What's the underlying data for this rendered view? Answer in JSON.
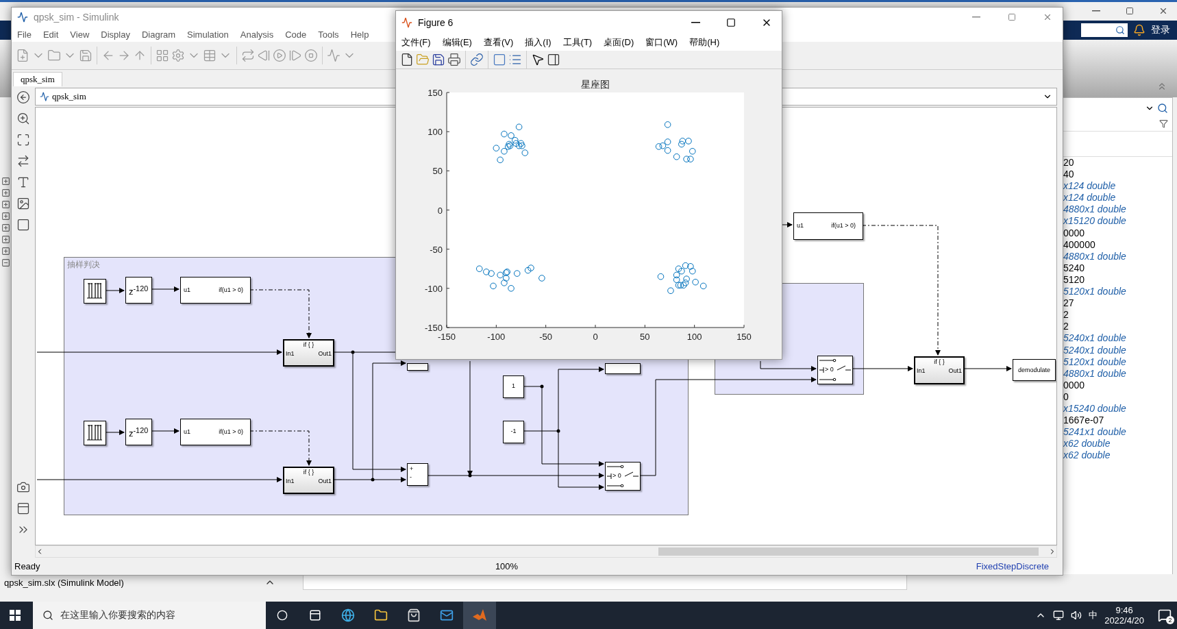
{
  "matlab_desktop": {
    "sign_in": "登录",
    "workspace_values": [
      {
        "value": "20",
        "kind": "scalar"
      },
      {
        "value": "40",
        "kind": "scalar"
      },
      {
        "value": "x124 double",
        "kind": "array"
      },
      {
        "value": "x124 double",
        "kind": "array"
      },
      {
        "value": "4880x1 double",
        "kind": "array"
      },
      {
        "value": "x15120 double",
        "kind": "array"
      },
      {
        "value": "0000",
        "kind": "scalar"
      },
      {
        "value": "400000",
        "kind": "scalar"
      },
      {
        "value": "4880x1 double",
        "kind": "array"
      },
      {
        "value": "5240",
        "kind": "scalar"
      },
      {
        "value": "5120",
        "kind": "scalar"
      },
      {
        "value": "5120x1 double",
        "kind": "array"
      },
      {
        "value": "27",
        "kind": "scalar"
      },
      {
        "value": "2",
        "kind": "scalar"
      },
      {
        "value": "2",
        "kind": "scalar"
      },
      {
        "value": "5240x1 double",
        "kind": "array"
      },
      {
        "value": "5240x1 double",
        "kind": "array"
      },
      {
        "value": "5120x1 double",
        "kind": "array"
      },
      {
        "value": "4880x1 double",
        "kind": "array"
      },
      {
        "value": "0000",
        "kind": "scalar"
      },
      {
        "value": "0",
        "kind": "scalar"
      },
      {
        "value": "x15240 double",
        "kind": "array"
      },
      {
        "value": "1667e-07",
        "kind": "scalar"
      },
      {
        "value": "5241x1 double",
        "kind": "array"
      },
      {
        "value": "x62 double",
        "kind": "array"
      },
      {
        "value": "x62 double",
        "kind": "array"
      }
    ],
    "file_bar": {
      "label": "qpsk_sim.slx  (Simulink Model)"
    }
  },
  "simulink": {
    "title": "qpsk_sim - Simulink",
    "menu": [
      "File",
      "Edit",
      "View",
      "Display",
      "Diagram",
      "Simulation",
      "Analysis",
      "Code",
      "Tools",
      "Help"
    ],
    "tabs": [
      {
        "label": "qpsk_sim",
        "selected": true
      }
    ],
    "breadcrumb": "qpsk_sim",
    "diagram": {
      "area_label": "抽样判决",
      "blocks": [
        {
          "kind": "repeating"
        },
        {
          "kind": "delay",
          "text": "z$^{-120}$"
        },
        {
          "kind": "compare",
          "input": "u1",
          "condition": "if(u1 > 0)"
        },
        {
          "kind": "action",
          "title": "if { }",
          "input": "In1",
          "output": "Out1"
        },
        {
          "kind": "repeating"
        },
        {
          "kind": "delay",
          "text": "z$^{-120}$"
        },
        {
          "kind": "compare",
          "input": "u1",
          "condition": "if(u1 > 0)"
        },
        {
          "kind": "action",
          "title": "if { }",
          "input": "In1",
          "output": "Out1"
        },
        {
          "kind": "sum"
        },
        {
          "kind": "sum",
          "signs": [
            "+",
            "-"
          ]
        },
        {
          "kind": "constant",
          "text": "1"
        },
        {
          "kind": "constant",
          "text": "-1"
        },
        {
          "kind": "switch"
        },
        {
          "kind": "switch",
          "text": "> 0"
        },
        {
          "kind": "compare",
          "input": "u1",
          "condition": "if(u1 > 0)"
        },
        {
          "kind": "switch",
          "text": "> 0"
        },
        {
          "kind": "action",
          "title": "if { }",
          "input": "In1",
          "output": "Out1"
        },
        {
          "kind": "sink",
          "text": "demodulate"
        }
      ]
    },
    "status": {
      "state": "Ready",
      "zoom": "100%",
      "solver": "FixedStepDiscrete"
    }
  },
  "figure": {
    "title": "Figure 6",
    "menu": [
      "文件(F)",
      "编辑(E)",
      "查看(V)",
      "插入(I)",
      "工具(T)",
      "桌面(D)",
      "窗口(W)",
      "帮助(H)"
    ],
    "chart_data": {
      "type": "scatter",
      "title": "星座图",
      "xlim": [
        -150,
        150
      ],
      "ylim": [
        -150,
        150
      ],
      "xticks": [
        -150,
        -100,
        -50,
        0,
        50,
        100,
        150
      ],
      "yticks": [
        -150,
        -100,
        -50,
        0,
        50,
        100,
        150
      ],
      "series": [
        {
          "color": "#0072bd",
          "x": [
            -77,
            -92,
            -85,
            -81,
            -87,
            -80,
            -75,
            -77,
            -74,
            -86,
            -88,
            -100,
            -92,
            -71,
            -96,
            73,
            73,
            64,
            68,
            73,
            87,
            88,
            94,
            98,
            82,
            92,
            96,
            -117,
            -110,
            -105,
            -96,
            -90,
            -89,
            -90,
            -92,
            -103,
            -85,
            -79,
            -68,
            -65,
            -54,
            66,
            84,
            87,
            91,
            96,
            98,
            82,
            82,
            92,
            101,
            109,
            76,
            84,
            86,
            89,
            91
          ],
          "values": [
            106,
            97,
            95,
            89,
            84,
            85,
            85,
            82,
            82,
            82,
            81,
            79,
            75,
            73,
            64,
            109,
            87,
            81,
            82,
            76,
            84,
            88,
            88,
            75,
            68,
            65,
            65,
            -75,
            -79,
            -81,
            -83,
            -80,
            -79,
            -87,
            -93,
            -97,
            -100,
            -81,
            -77,
            -74,
            -87,
            -85,
            -75,
            -78,
            -71,
            -72,
            -78,
            -83,
            -89,
            -88,
            -92,
            -97,
            -103,
            -96,
            -96,
            -96,
            -93
          ]
        }
      ]
    }
  },
  "taskbar": {
    "search_placeholder": "在这里输入你要搜索的内容",
    "ime": "中",
    "time": "9:46",
    "date": "2022/4/20",
    "notifications": "2"
  }
}
